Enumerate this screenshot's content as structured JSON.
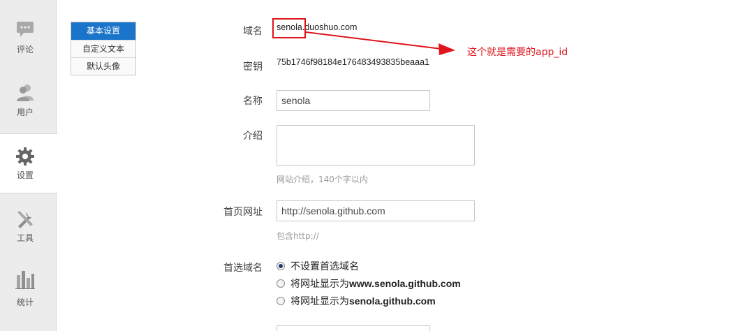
{
  "sidebar": {
    "items": [
      {
        "label": "评论",
        "icon": "comment-icon"
      },
      {
        "label": "用户",
        "icon": "users-icon"
      },
      {
        "label": "设置",
        "icon": "gear-icon"
      },
      {
        "label": "工具",
        "icon": "tools-icon"
      },
      {
        "label": "统计",
        "icon": "stats-icon"
      }
    ],
    "active_index": 2
  },
  "subtabs": [
    {
      "label": "基本设置"
    },
    {
      "label": "自定义文本"
    },
    {
      "label": "默认头像"
    }
  ],
  "form": {
    "domain": {
      "label": "域名",
      "prefix": "senola",
      "suffix": ".duoshuo.com"
    },
    "secret": {
      "label": "密钥",
      "value": "75b1746f98184e176483493835beaaa1"
    },
    "name": {
      "label": "名称",
      "value": "senola"
    },
    "intro": {
      "label": "介绍",
      "value": "",
      "hint": "网站介绍，140个字以内"
    },
    "homepage": {
      "label": "首页网址",
      "value": "http://senola.github.com",
      "hint": "包含http://"
    },
    "preferred_domain": {
      "label": "首选域名",
      "options": [
        {
          "prefix": "不设置首选域名",
          "bold": "",
          "selected": true
        },
        {
          "prefix": "将网址显示为",
          "bold": "www.senola.github.com",
          "selected": false
        },
        {
          "prefix": "将网址显示为",
          "bold": "senola.github.com",
          "selected": false
        }
      ]
    }
  },
  "annotation": {
    "text": "这个就是需要的app_id",
    "color": "#e0141c"
  },
  "colors": {
    "accent": "#1a74c9",
    "annotation": "#e0141c"
  }
}
